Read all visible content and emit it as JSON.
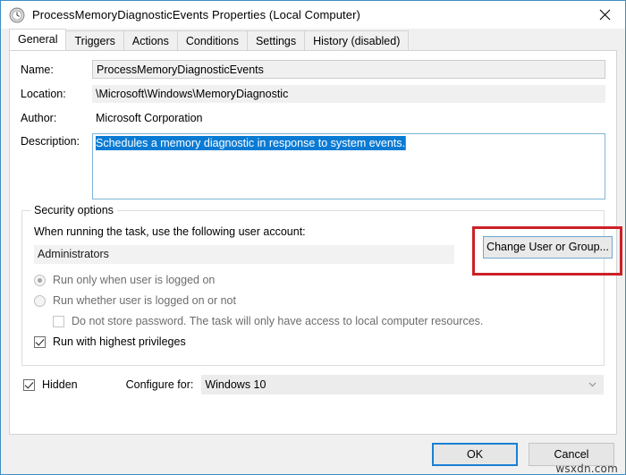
{
  "window": {
    "title": "ProcessMemoryDiagnosticEvents Properties (Local Computer)",
    "icon": "clock-schedule-icon",
    "close_label": "✕",
    "accent_border": "#3d8fc4"
  },
  "tabs": [
    {
      "label": "General",
      "active": true
    },
    {
      "label": "Triggers",
      "active": false
    },
    {
      "label": "Actions",
      "active": false
    },
    {
      "label": "Conditions",
      "active": false
    },
    {
      "label": "Settings",
      "active": false
    },
    {
      "label": "History (disabled)",
      "active": false
    }
  ],
  "general": {
    "name": {
      "label": "Name:",
      "value": "ProcessMemoryDiagnosticEvents"
    },
    "location": {
      "label": "Location:",
      "value": "\\Microsoft\\Windows\\MemoryDiagnostic"
    },
    "author": {
      "label": "Author:",
      "value": "Microsoft Corporation"
    },
    "description": {
      "label": "Description:",
      "value": "Schedules a memory diagnostic in response to system events.",
      "selected": true,
      "selection_color": "#0a7bd4"
    }
  },
  "security_options": {
    "title": "Security options",
    "account_prompt": "When running the task, use the following user account:",
    "account_value": "Administrators",
    "change_user_button": "Change User or Group...",
    "highlight_color": "#cc2127",
    "radios": [
      {
        "label": "Run only when user is logged on",
        "checked": true,
        "disabled": true
      },
      {
        "label": "Run whether user is logged on or not",
        "checked": false,
        "disabled": true
      }
    ],
    "do_not_store_password": {
      "label": "Do not store password.  The task will only have access to local computer resources.",
      "checked": false,
      "disabled": true
    },
    "run_highest_privileges": {
      "label": "Run with highest privileges",
      "checked": true,
      "disabled": false
    }
  },
  "bottom": {
    "hidden": {
      "label": "Hidden",
      "checked": true
    },
    "configure_for_label": "Configure for:",
    "configure_for_value": "Windows 10",
    "configure_for_arrow": "chevron-down-icon"
  },
  "footer": {
    "ok": "OK",
    "cancel": "Cancel",
    "watermark": "wsxdn.com"
  }
}
